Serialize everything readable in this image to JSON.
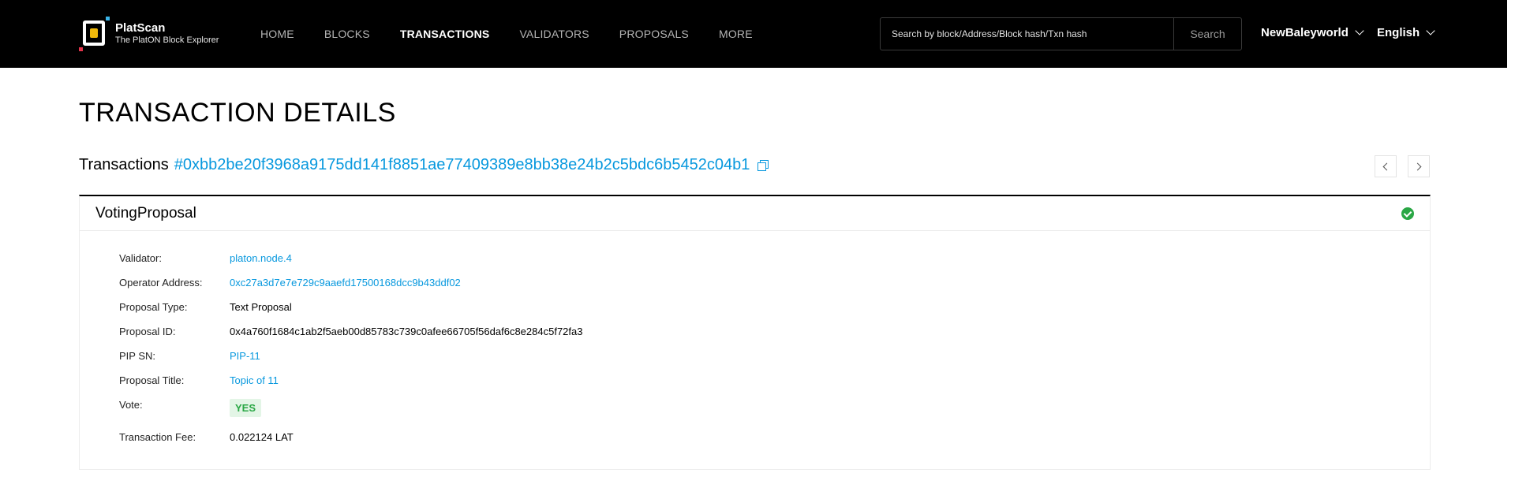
{
  "brand": {
    "name": "PlatScan",
    "subtitle": "The PlatON Block Explorer"
  },
  "nav": {
    "home": "HOME",
    "blocks": "BLOCKS",
    "transactions": "TRANSACTIONS",
    "validators": "VALIDATORS",
    "proposals": "PROPOSALS",
    "more": "MORE",
    "active": "TRANSACTIONS"
  },
  "search": {
    "placeholder": "Search by block/Address/Block hash/Txn hash",
    "button": "Search"
  },
  "network_select": "NewBaleyworld",
  "language_select": "English",
  "page_title": "TRANSACTION DETAILS",
  "tx": {
    "prefix": "Transactions",
    "hash": "#0xbb2be20f3968a9175dd141f8851ae77409389e8bb38e24b2c5bdc6b5452c04b1"
  },
  "card": {
    "title": "VotingProposal",
    "status": "success",
    "status_color": "#2aa745"
  },
  "details": {
    "validator_label": "Validator:",
    "validator_value": "platon.node.4",
    "operator_label": "Operator Address:",
    "operator_value": "0xc27a3d7e7e729c9aaefd17500168dcc9b43ddf02",
    "proposal_type_label": "Proposal Type:",
    "proposal_type_value": "Text Proposal",
    "proposal_id_label": "Proposal ID:",
    "proposal_id_value": "0x4a760f1684c1ab2f5aeb00d85783c739c0afee66705f56daf6c8e284c5f72fa3",
    "pip_label": "PIP SN:",
    "pip_value": "PIP-11",
    "proposal_title_label": "Proposal Title:",
    "proposal_title_value": "Topic of 11",
    "vote_label": "Vote:",
    "vote_value": "YES",
    "fee_label": "Transaction Fee:",
    "fee_value": "0.022124 LAT"
  },
  "colors": {
    "link": "#0798de",
    "header_bg": "#000000",
    "success": "#2aa745"
  }
}
